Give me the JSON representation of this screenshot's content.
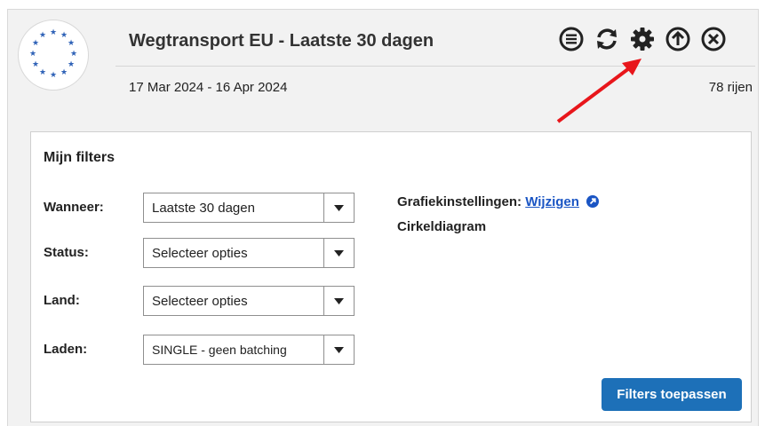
{
  "header": {
    "title": "Wegtransport EU - Laatste 30 dagen",
    "date_range": "17 Mar 2024 - 16 Apr 2024",
    "row_count": "78 rijen",
    "logo": "eu-stars-logo",
    "tools": [
      "menu-circle-icon",
      "refresh-icon",
      "gear-icon",
      "arrow-up-circle-icon",
      "close-circle-icon"
    ]
  },
  "annotation": {
    "arrow_color": "#e8161b"
  },
  "filters": {
    "title": "Mijn filters",
    "wanneer": {
      "label": "Wanneer:",
      "value": "Laatste 30 dagen"
    },
    "status": {
      "label": "Status:",
      "value": "Selecteer opties"
    },
    "land": {
      "label": "Land:",
      "value": "Selecteer opties"
    },
    "laden": {
      "label": "Laden:",
      "value": "SINGLE - geen batching"
    },
    "chart_settings_label": "Grafiekinstellingen:",
    "chart_settings_link": "Wijzigen",
    "chart_type": "Cirkeldiagram",
    "apply_button": "Filters toepassen",
    "accent_color": "#1d70b8"
  }
}
